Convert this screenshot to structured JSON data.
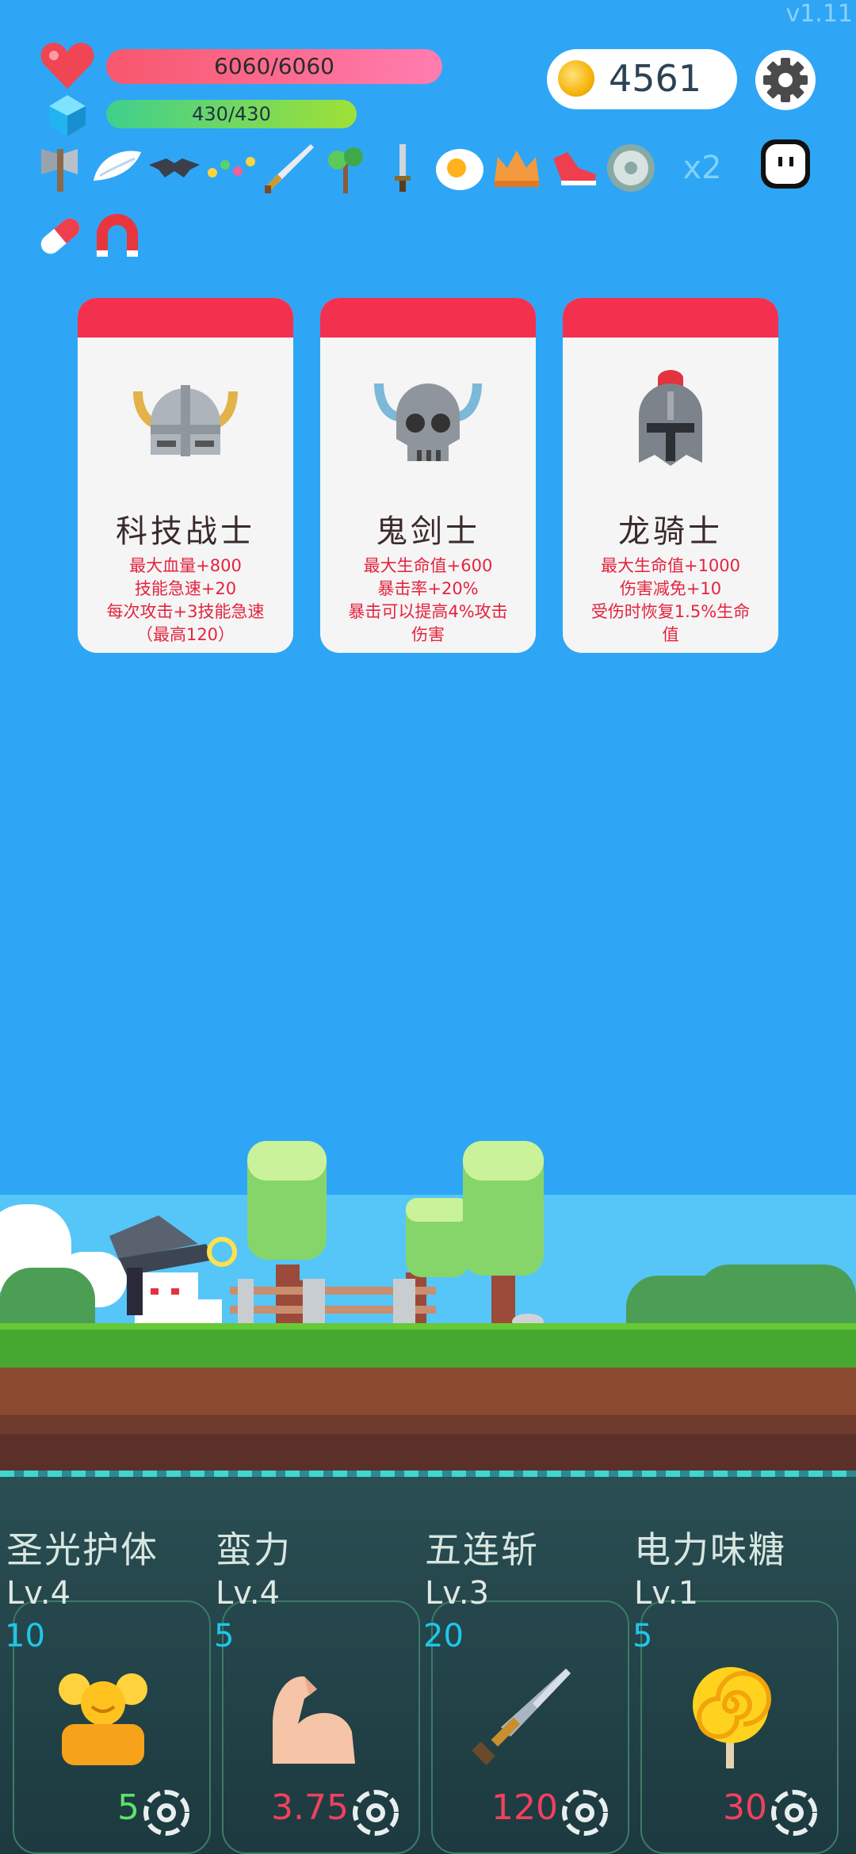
{
  "version": "v1.11",
  "status": {
    "hp_text": "6060/6060",
    "mp_text": "430/430",
    "coins": "4561"
  },
  "icons": {
    "heart": "heart-icon",
    "crystal": "crystal-icon",
    "coin": "coin-icon",
    "settings": "gear-icon",
    "ghost": "ghost-icon"
  },
  "items": {
    "list": [
      "axe",
      "wing",
      "bat",
      "chain",
      "sword",
      "sapling",
      "dagger",
      "egg",
      "crown",
      "sneaker",
      "shield",
      "pill",
      "magnet"
    ],
    "multiplier": "x2"
  },
  "cards": [
    {
      "name": "科技战士",
      "desc": "最大血量+800\n技能急速+20\n每次攻击+3技能急速\n（最高120）",
      "icon": "viking-helmet-icon"
    },
    {
      "name": "鬼剑士",
      "desc": "最大生命值+600\n暴击率+20%\n暴击可以提高4%攻击\n伤害",
      "icon": "skull-helmet-icon"
    },
    {
      "name": "龙骑士",
      "desc": "最大生命值+1000\n伤害减免+10\n受伤时恢复1.5%生命\n值",
      "icon": "knight-helmet-icon"
    }
  ],
  "skills": [
    {
      "name": "圣光护体",
      "level": "Lv.4",
      "count": "10",
      "cost": "5",
      "cost_color": "#5be36b",
      "icon": "golden-idol-icon"
    },
    {
      "name": "蛮力",
      "level": "Lv.4",
      "count": "5",
      "cost": "3.75",
      "cost_color": "#f2405f",
      "icon": "muscle-arm-icon"
    },
    {
      "name": "五连斩",
      "level": "Lv.3",
      "count": "20",
      "cost": "120",
      "cost_color": "#f2405f",
      "icon": "sword-icon"
    },
    {
      "name": "电力味糖",
      "level": "Lv.1",
      "count": "5",
      "cost": "30",
      "cost_color": "#f2405f",
      "icon": "lollipop-icon"
    }
  ]
}
